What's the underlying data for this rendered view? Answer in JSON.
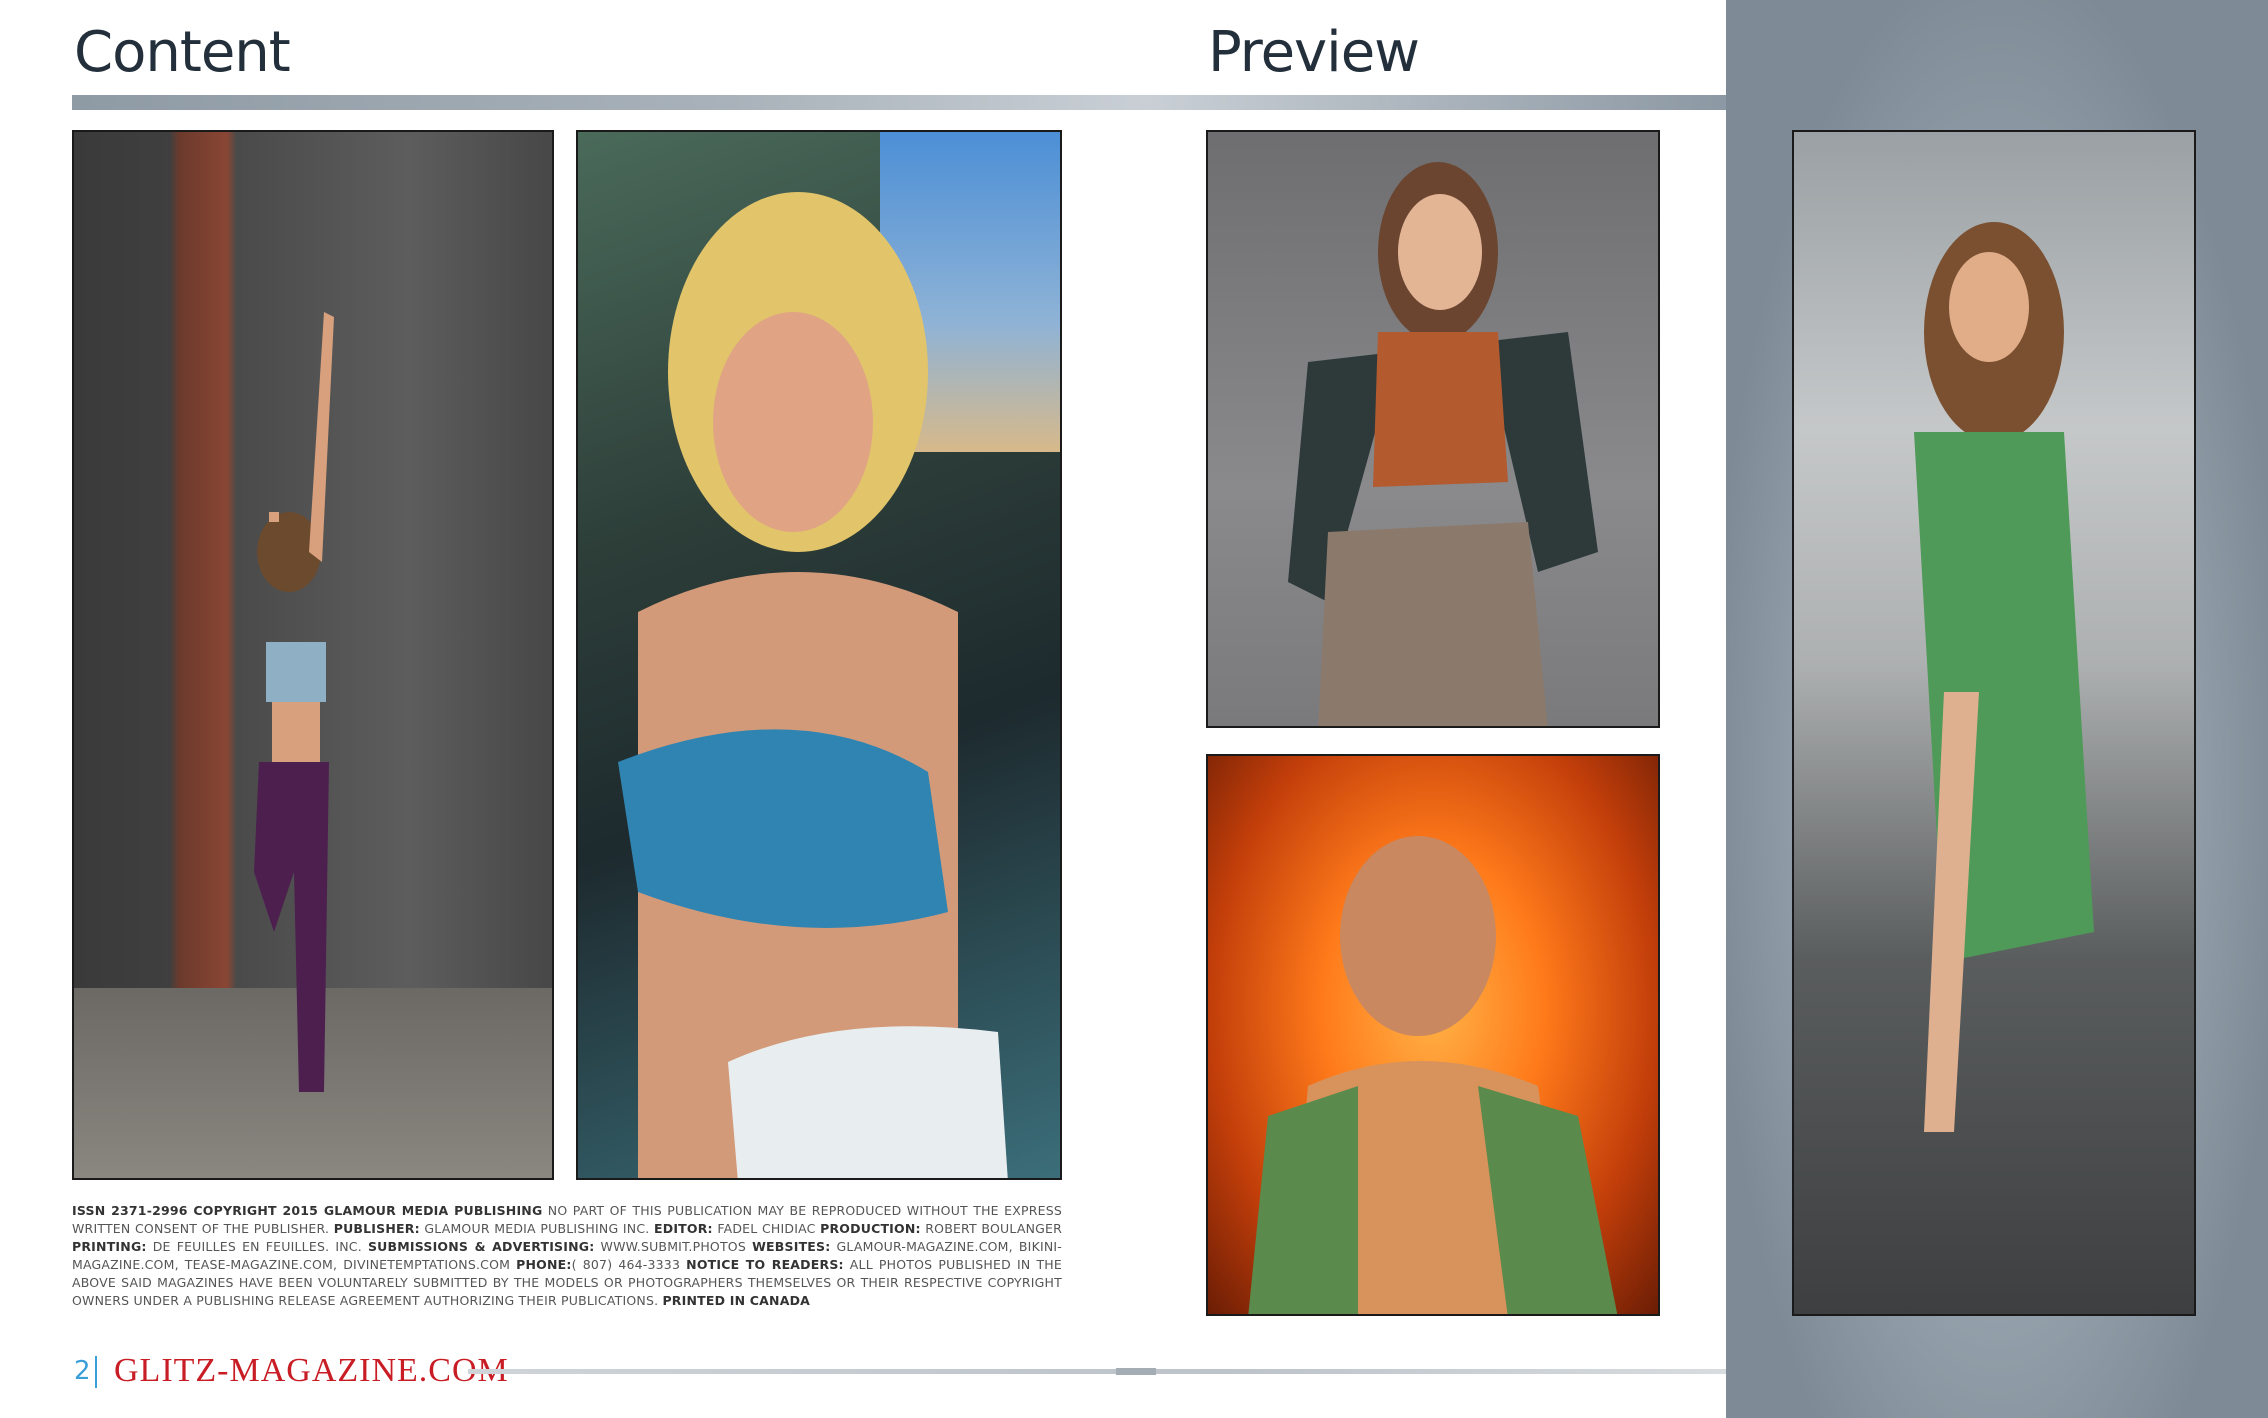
{
  "headings": {
    "content": "Content",
    "preview": "Preview"
  },
  "photos": [
    {
      "name": "Dancer posing against brick wall"
    },
    {
      "name": "Blonde woman in blue top"
    },
    {
      "name": "Young woman in orange crop top"
    },
    {
      "name": "Bald man in orange light"
    },
    {
      "name": "Woman in green dress on stone stairs"
    }
  ],
  "legal": {
    "issn": "ISSN 2371-2996 COPYRIGHT 2015 GLAMOUR MEDIA PUBLISHING",
    "notice": " NO PART OF THIS PUBLICATION MAY BE REPRODUCED WITHOUT THE EXPRESS WRITTEN CONSENT OF THE PUBLISHER. ",
    "publisher_label": "PUBLISHER:",
    "publisher": " GLAMOUR MEDIA PUBLISHING INC. ",
    "editor_label": "EDITOR:",
    "editor": " FADEL CHIDIAC ",
    "production_label": "PRODUCTION:",
    "production": " ROBERT BOULANGER ",
    "printing_label": "PRINTING:",
    "printing": " DE FEUILLES EN FEUILLES. INC. ",
    "submissions_label": "SUBMISSIONS & ADVERTISING:",
    "submissions": " WWW.SUBMIT.PHOTOS ",
    "websites_label": "WEBSITES:",
    "websites": " GLAMOUR-MAGAZINE.COM, BIKINI-MAGAZINE.COM, TEASE-MAGAZINE.COM, DIVINETEMPTATIONS.COM ",
    "phone_label": "PHONE:",
    "phone": "( 807) 464-3333 ",
    "readers_label": "NOTICE TO READERS:",
    "readers": " ALL PHOTOS PUBLISHED IN THE ABOVE SAID MAGAZINES HAVE BEEN VOLUNTARELY SUBMITTED BY THE MODELS OR PHOTOGRAPHERS THEMSELVES OR THEIR RESPECTIVE COPYRIGHT OWNERS UNDER A PUBLISHING RELEASE AGREEMENT AUTHORIZING THEIR PUBLICATIONS. ",
    "printed": "PRINTED IN CANADA"
  },
  "footer": {
    "page_number": "2",
    "site": "GLITZ-MAGAZINE.COM"
  },
  "colors": {
    "accent_blue": "#3a9fd8",
    "brand_red": "#c91d25",
    "panel_gray": "#7e8b96"
  }
}
